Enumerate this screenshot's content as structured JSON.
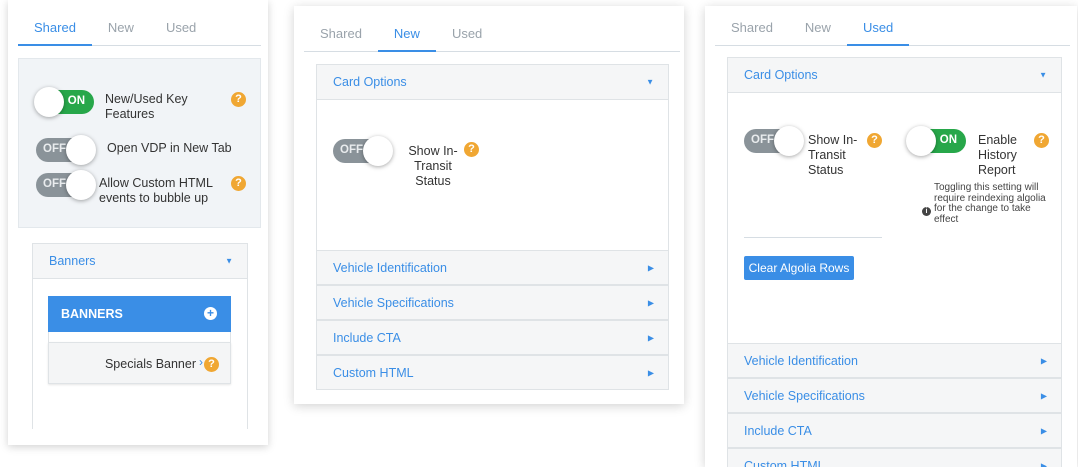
{
  "tabs": [
    "Shared",
    "New",
    "Used"
  ],
  "panel_shared": {
    "settings": [
      {
        "state": "ON",
        "label": "New/Used Key Features"
      },
      {
        "state": "OFF",
        "label": "Open VDP in New Tab"
      },
      {
        "state": "OFF",
        "label": "Allow Custom HTML events to bubble up"
      }
    ],
    "banners_section": "Banners",
    "banners_header": "BANNERS",
    "banner_item": "Specials Banner"
  },
  "panel_new": {
    "card_options": "Card Options",
    "transit_toggle": "OFF",
    "transit_label": "Show In-Transit Status",
    "sections": [
      "Vehicle Identification",
      "Vehicle Specifications",
      "Include CTA",
      "Custom HTML"
    ]
  },
  "panel_used": {
    "card_options": "Card Options",
    "transit_toggle": "OFF",
    "transit_label": "Show In-Transit Status",
    "history_toggle": "ON",
    "history_label": "Enable History Report",
    "note": "Toggling this setting will require reindexing algolia for the change to take effect",
    "clear_button": "Clear Algolia Rows",
    "sections": [
      "Vehicle Identification",
      "Vehicle Specifications",
      "Include CTA",
      "Custom HTML"
    ]
  },
  "help_glyph": "?",
  "colors": {
    "accent": "#3a8ee6",
    "on": "#27a74a",
    "off": "#8a9399",
    "help": "#f0a733"
  }
}
